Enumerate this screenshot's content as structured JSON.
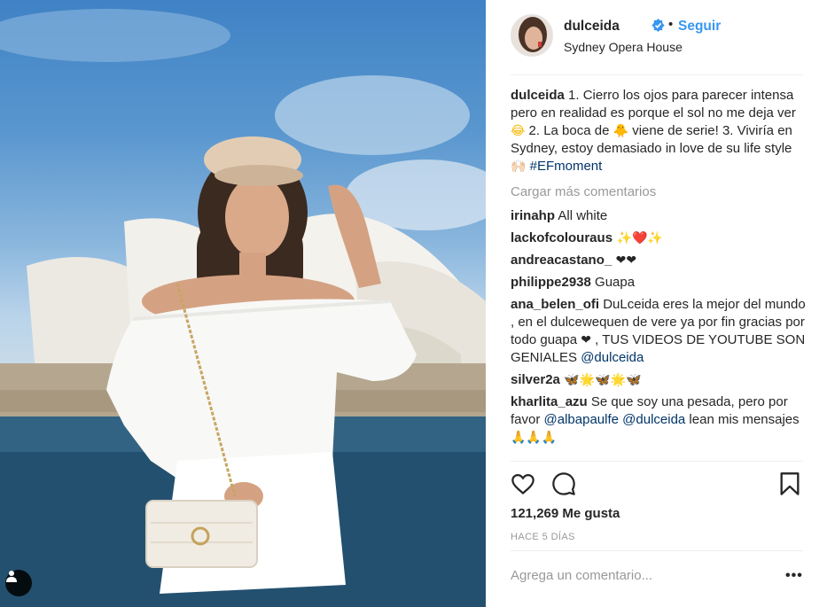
{
  "post": {
    "username": "dulceida",
    "follow_label": "Seguir",
    "separator": "•",
    "location": "Sydney Opera House"
  },
  "caption": {
    "username": "dulceida",
    "text1": " 1. Cierro los ojos para parecer intensa pero en realidad es porque el sol no me deja ver ",
    "emoji1": "😂",
    "text2": " 2. La boca de ",
    "emoji2": "🐥",
    "text3": " viene de serie! 3. Viviría en Sydney, estoy demasiado in love de su life style ",
    "emoji3": "🙌🏻",
    "hashtag": "#EFmoment"
  },
  "load_more_label": "Cargar más comentarios",
  "comments": [
    {
      "user": "irinahp",
      "text": " All white"
    },
    {
      "user": "lackofcolouraus",
      "emoji_a": " ✨",
      "emoji_b": "❤️",
      "emoji_c": "✨"
    },
    {
      "user": "andreacastano_",
      "emoji": " ❤❤"
    },
    {
      "user": "philippe2938",
      "text": " Guapa"
    },
    {
      "user": "ana_belen_ofi",
      "text": " DuLceida eres la mejor del mundo , en el dulcewequen de vere ya por fin gracias por todo guapa ",
      "heart": "❤",
      "text2": " , TUS VIDEOS DE YOUTUBE SON GENIALES ",
      "mention": "@dulceida"
    },
    {
      "user": "silver2a",
      "emoji_a": " 🦋",
      "emoji_b": "🌟",
      "emoji_c": "🦋",
      "emoji_d": "🌟",
      "emoji_e": "🦋"
    },
    {
      "user": "kharlita_azu",
      "text": " Se que soy una pesada, pero por favor ",
      "mention1": "@albapaulfe",
      "mention2": "@dulceida",
      "text2": " lean mis mensajes ",
      "emoji": "🙏🙏🙏"
    }
  ],
  "likes_label": "121,269 Me gusta",
  "time_ago": "HACE 5 DÍAS",
  "add_comment_placeholder": "Agrega un comentario...",
  "more_options": "•••",
  "icons": [
    "heart-icon",
    "comment-icon",
    "bookmark-icon",
    "verified-badge-icon",
    "tag-person-icon"
  ],
  "colors": {
    "link": "#3897f0",
    "hashtag": "#003569",
    "muted": "#999999",
    "text": "#262626",
    "border": "#efefef"
  }
}
